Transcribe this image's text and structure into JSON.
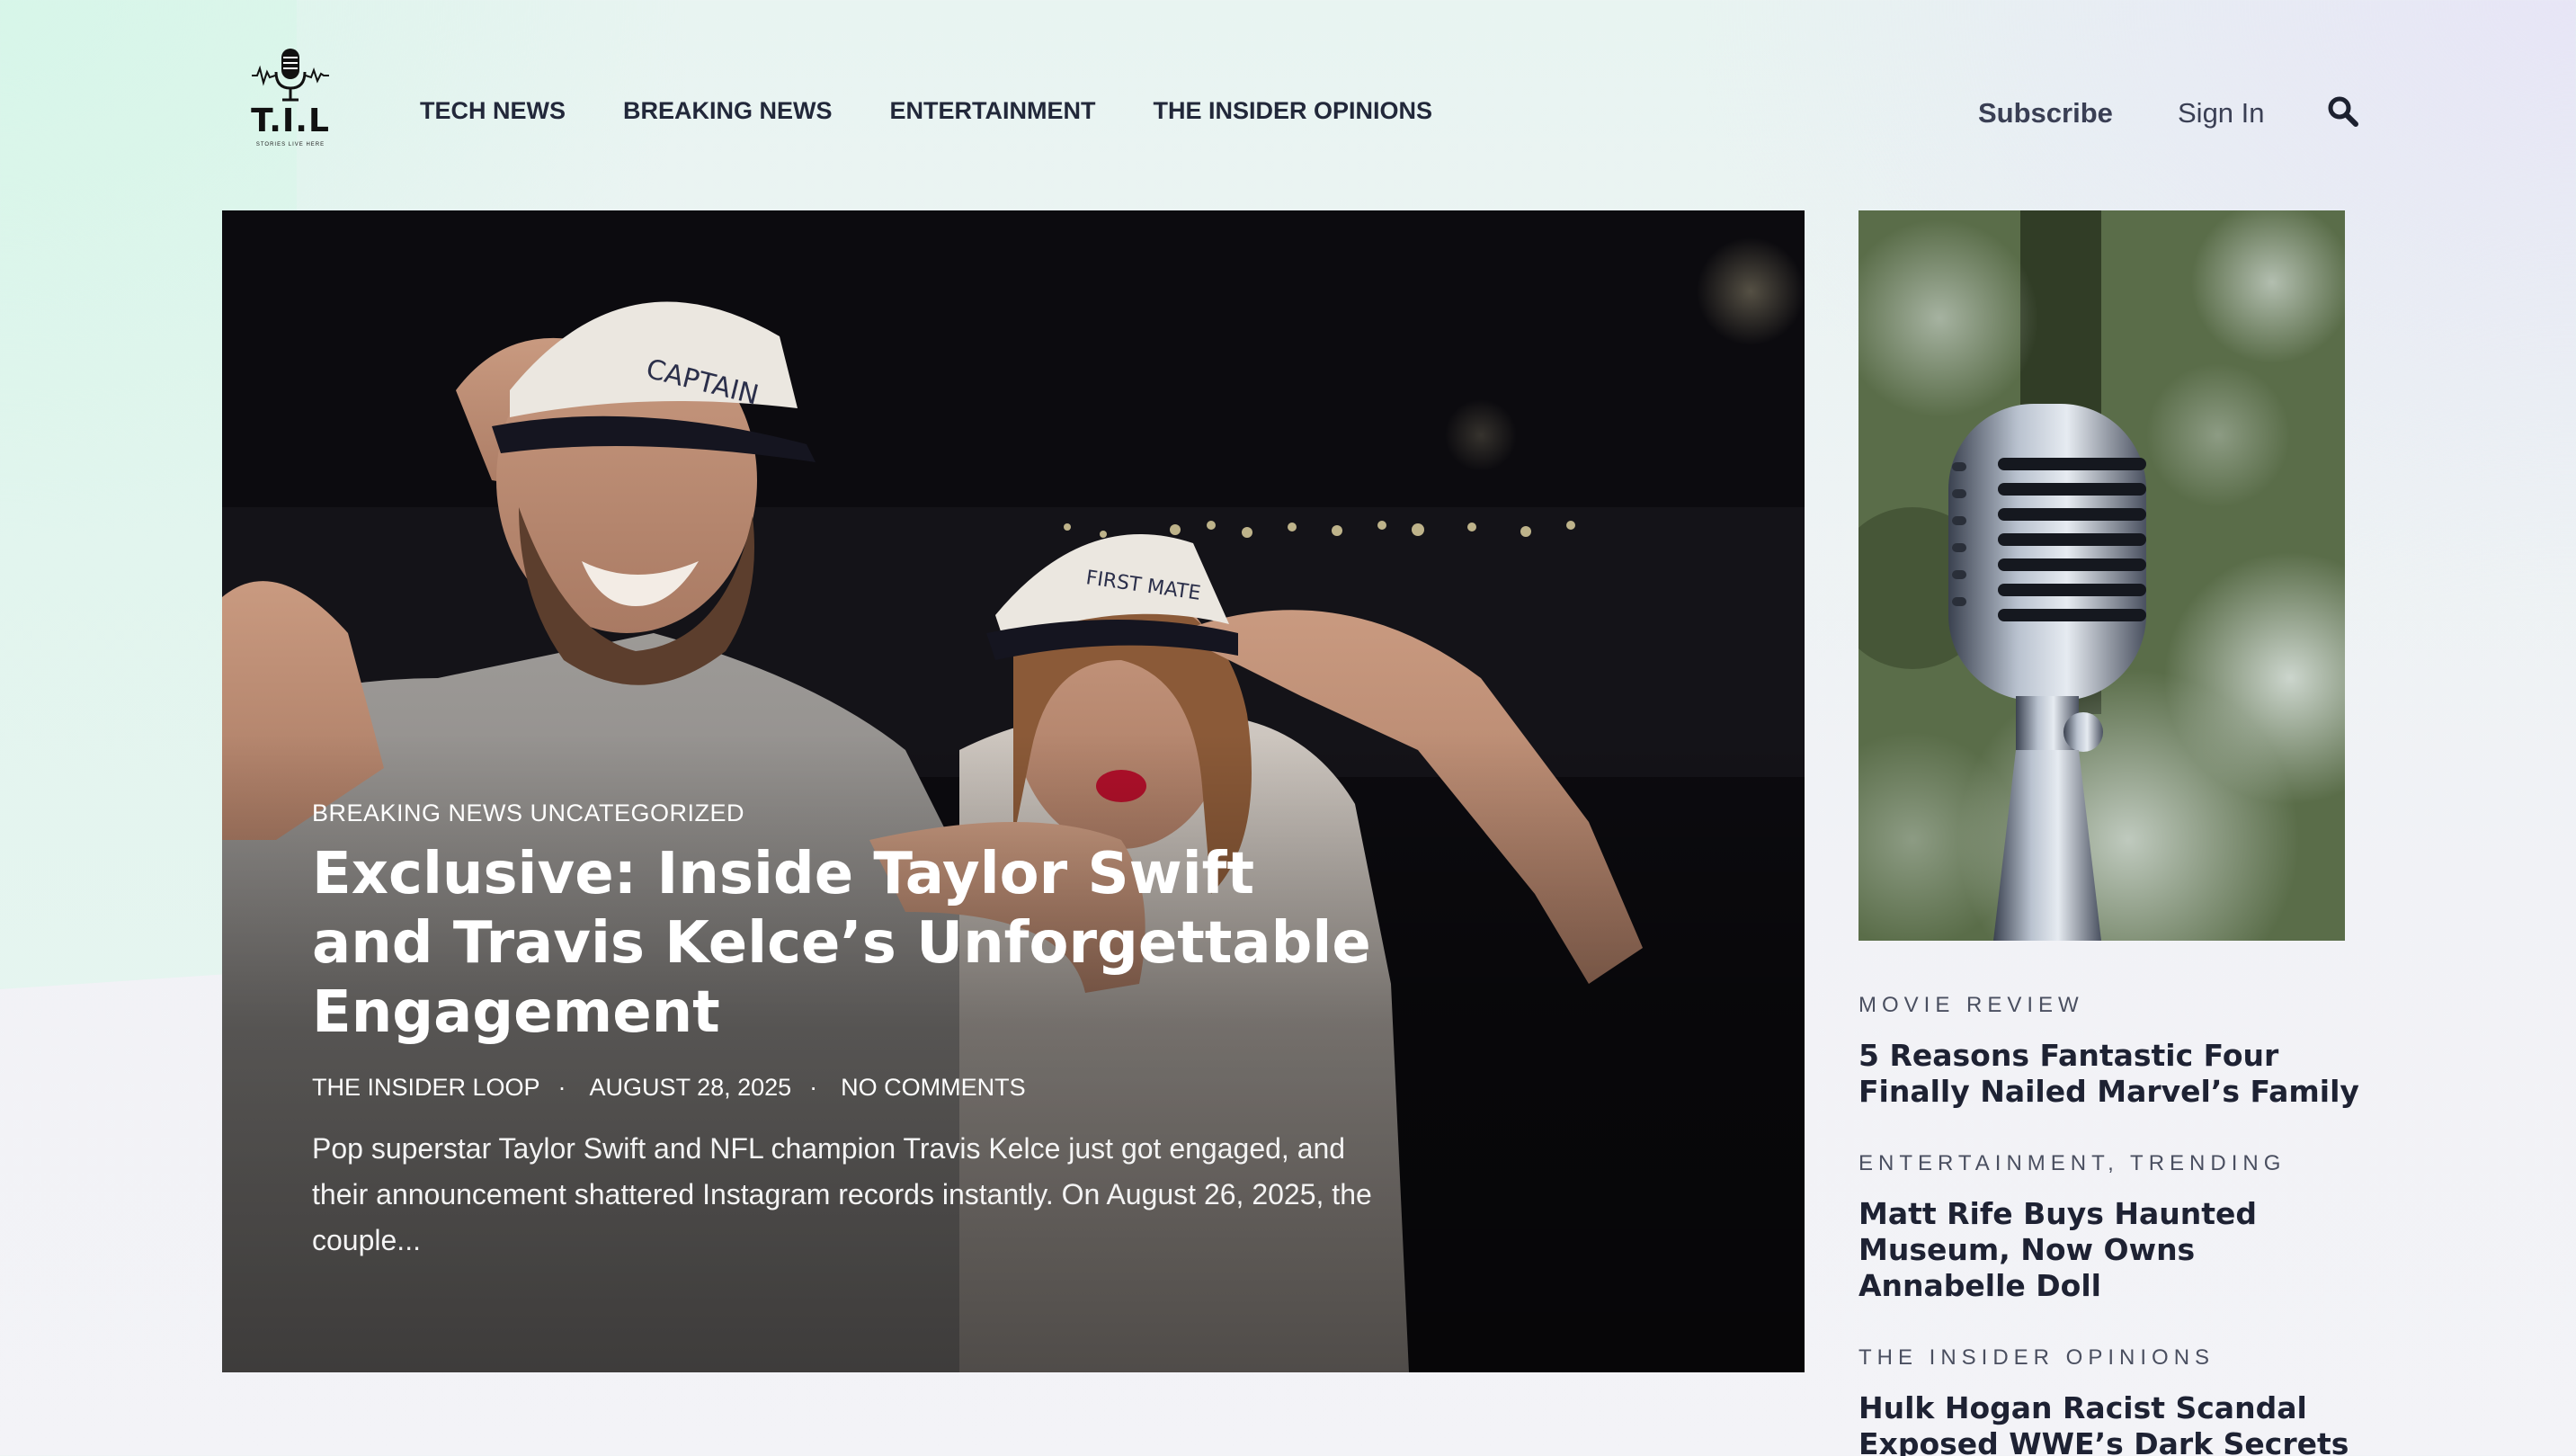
{
  "site": {
    "logo_text": "T.I.L",
    "logo_tagline": "STORIES LIVE HERE"
  },
  "nav": {
    "items": [
      {
        "label": "TECH NEWS"
      },
      {
        "label": "BREAKING NEWS"
      },
      {
        "label": "ENTERTAINMENT"
      },
      {
        "label": "THE INSIDER OPINIONS"
      }
    ]
  },
  "header": {
    "subscribe_label": "Subscribe",
    "signin_label": "Sign In",
    "search_icon": "search-icon"
  },
  "hero": {
    "categories": "BREAKING NEWS UNCATEGORIZED",
    "title": "Exclusive: Inside Taylor Swift and Travis Kelce’s Unforgettable Engagement",
    "author": "THE INSIDER LOOP",
    "date": "AUGUST 28, 2025",
    "comments": "NO COMMENTS",
    "meta_separator": "·",
    "excerpt": "Pop superstar Taylor Swift and NFL champion Travis Kelce just got engaged, and their announcement shattered Instagram records instantly. On August 26, 2025, the couple..."
  },
  "sidebar": {
    "posts": [
      {
        "category": "MOVIE REVIEW",
        "title": "5 Reasons Fantastic Four Finally Nailed Marvel’s Family"
      },
      {
        "category": "ENTERTAINMENT,  TRENDING",
        "title": "Matt Rife Buys Haunted Museum, Now Owns Annabelle Doll"
      },
      {
        "category": "THE INSIDER OPINIONS",
        "title": "Hulk Hogan Racist Scandal Exposed WWE’s Dark Secrets"
      }
    ]
  },
  "colors": {
    "text_dark": "#1d2130",
    "nav_text": "#22283a",
    "hero_text": "#ffffff",
    "bg_mint": "#d9f5ea",
    "bg_lavender": "#e7e5f6"
  }
}
